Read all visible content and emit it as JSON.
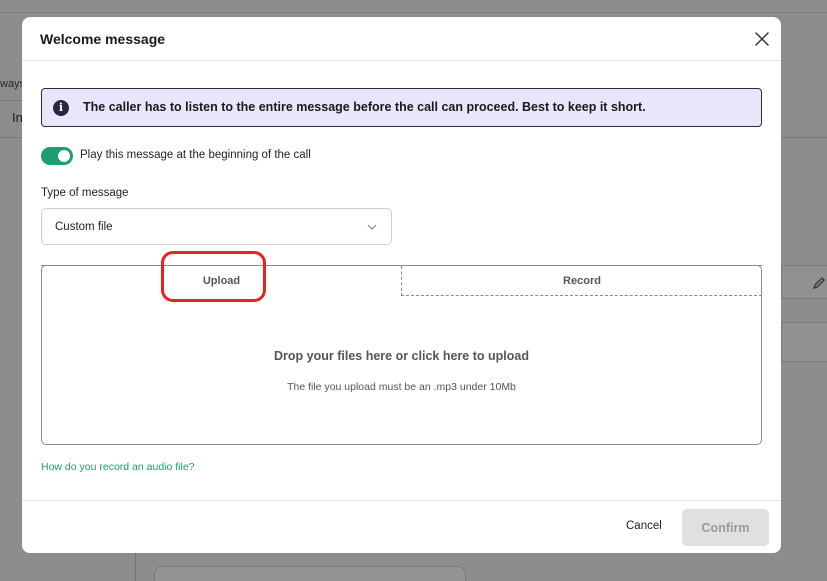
{
  "background": {
    "left_text_1": "ways",
    "left_text_2": "In"
  },
  "modal": {
    "title": "Welcome message",
    "close_icon": "close-icon",
    "info": {
      "icon": "info-icon",
      "icon_glyph": "i",
      "text": "The caller has to listen to the entire message before the call can proceed. Best to keep it short."
    },
    "toggle": {
      "on": true,
      "label": "Play this message at the beginning of the call",
      "color": "#1e9e6e"
    },
    "type_of_message": {
      "label": "Type of message",
      "selected": "Custom file"
    },
    "tabs": [
      {
        "label": "Upload",
        "active": true
      },
      {
        "label": "Record",
        "active": false
      }
    ],
    "drop_zone": {
      "title": "Drop your files here or click here to upload",
      "subtitle": "The file you upload must be an .mp3 under 10Mb"
    },
    "help_link": "How do you record an audio file?",
    "footer": {
      "cancel_label": "Cancel",
      "confirm_label": "Confirm"
    }
  },
  "colors": {
    "accent": "#1e9e6e",
    "info_bg": "#e8e6fb",
    "annotation_highlight": "#e8231e"
  }
}
